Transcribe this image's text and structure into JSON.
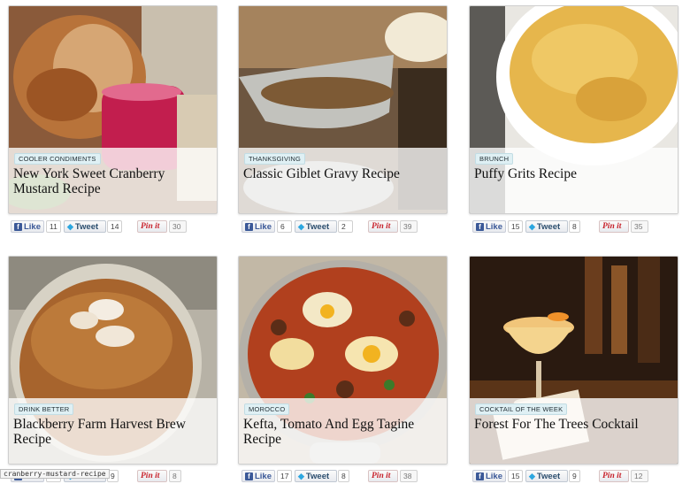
{
  "cards": [
    {
      "tag": "Cooler Condiments",
      "title": "New York Sweet Cranberry Mustard Recipe",
      "like_label": "Like",
      "like_count": "11",
      "tweet_label": "Tweet",
      "tweet_count": "14",
      "pin_label": "Pin it",
      "pin_count": "30"
    },
    {
      "tag": "Thanksgiving",
      "title": "Classic Giblet Gravy Recipe",
      "like_label": "Like",
      "like_count": "6",
      "tweet_label": "Tweet",
      "tweet_count": "2",
      "pin_label": "Pin it",
      "pin_count": "39"
    },
    {
      "tag": "Brunch",
      "title": "Puffy Grits Recipe",
      "like_label": "Like",
      "like_count": "15",
      "tweet_label": "Tweet",
      "tweet_count": "8",
      "pin_label": "Pin it",
      "pin_count": "35"
    },
    {
      "tag": "Drink Better",
      "title": "Blackberry Farm Harvest Brew Recipe",
      "like_label": "Like",
      "like_count": "",
      "tweet_label": "Tweet",
      "tweet_count": "9",
      "pin_label": "Pin it",
      "pin_count": "8"
    },
    {
      "tag": "Morocco",
      "title": "Kefta, Tomato And Egg Tagine Recipe",
      "like_label": "Like",
      "like_count": "17",
      "tweet_label": "Tweet",
      "tweet_count": "8",
      "pin_label": "Pin it",
      "pin_count": "38"
    },
    {
      "tag": "Cocktail of the Week",
      "title": "Forest For The Trees Cocktail",
      "like_label": "Like",
      "like_count": "15",
      "tweet_label": "Tweet",
      "tweet_count": "9",
      "pin_label": "Pin it",
      "pin_count": "12"
    }
  ],
  "status_tooltip": "cranberry-mustard-recipe",
  "icons": {
    "facebook": "facebook-icon",
    "twitter": "twitter-bird-icon",
    "pinterest": "pinterest-icon"
  },
  "colors": {
    "tag_bg": "#dff0f4",
    "facebook_blue": "#3b5998",
    "twitter_blue": "#2ca7e0",
    "pinterest_red": "#c8232c"
  }
}
